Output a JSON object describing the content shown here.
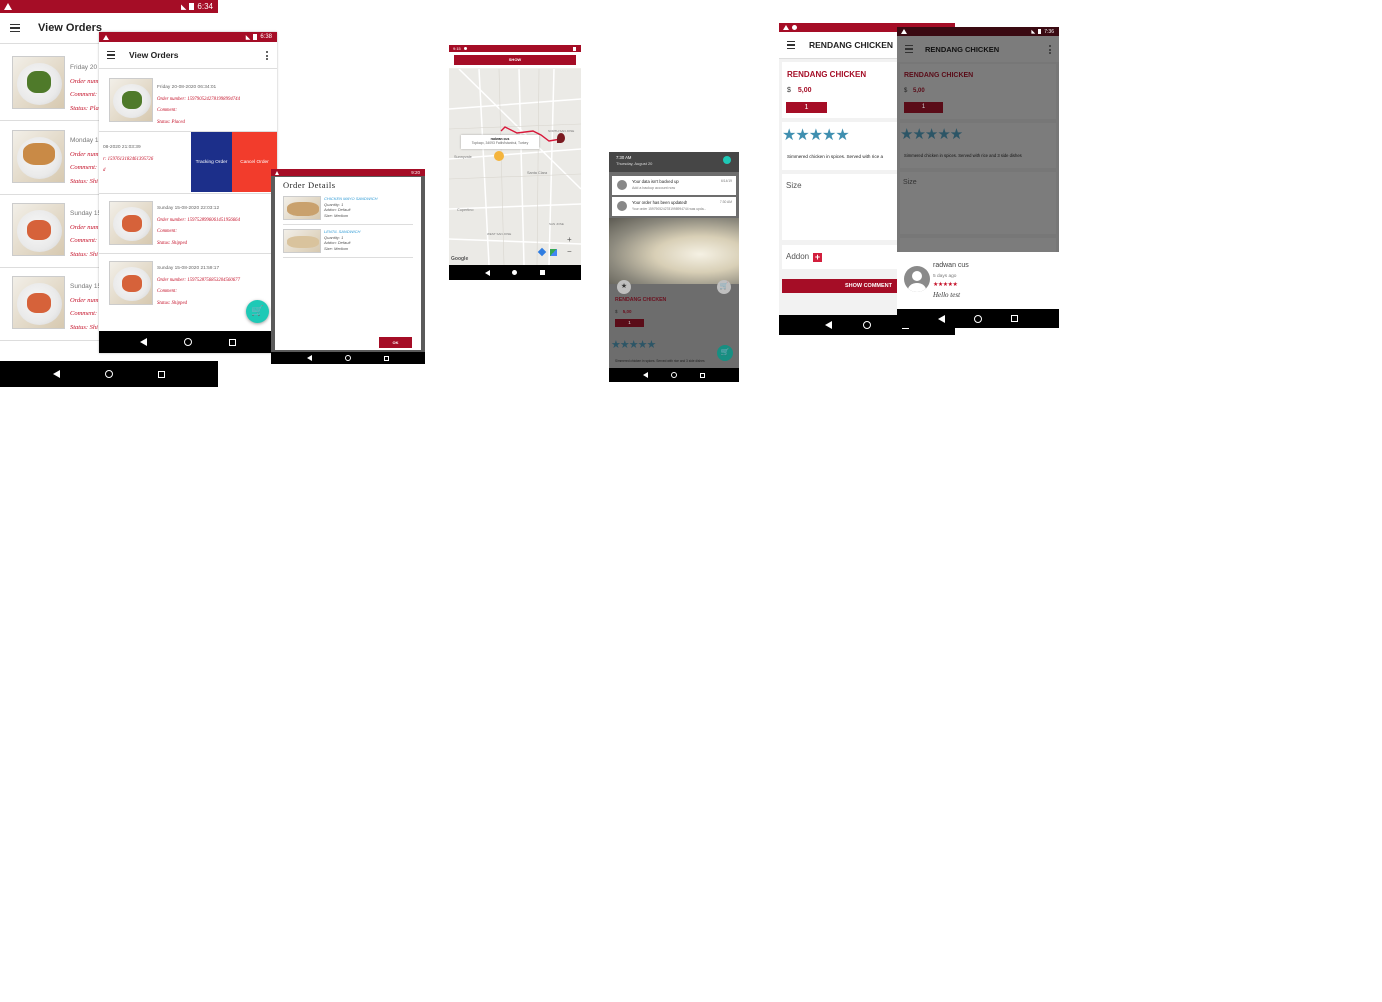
{
  "screen1": {
    "status_time": "6:34",
    "title": "View Orders",
    "rows": [
      {
        "date": "Friday 20",
        "order": "Order num",
        "comment": "Comment:",
        "status": "Status: Plac"
      },
      {
        "date": "Monday 1",
        "order": "Order num",
        "comment": "Comment:",
        "status": "Status: Shi"
      },
      {
        "date": "Sunday 15",
        "order": "Order num",
        "comment": "Comment:",
        "status": "Status: Shi"
      },
      {
        "date": "Sunday 15",
        "order": "Order num",
        "comment": "Comment:",
        "status": "Status: Shi"
      }
    ]
  },
  "screen2": {
    "status_time": "6:38",
    "title": "View Orders",
    "rows": [
      {
        "date": "Friday 20-08-2020 06:34:01",
        "order": "Order number: 1597905242781998994744",
        "comment": "Comment:",
        "status": "Status: Placed"
      },
      {
        "date": "08-2020 21:03:39",
        "order": "r: 1597613182461395726",
        "comment": "",
        "status": "d"
      },
      {
        "date": "Sunday 15-08-2020 22:03:12",
        "order": "Order number: 1597528996061451956664",
        "comment": "Comment:",
        "status": "Status: Shipped"
      },
      {
        "date": "Sunday 15-08-2020 21:59:17",
        "order": "Order number: 1597528756853204560677",
        "comment": "Comment:",
        "status": "Status: Shipped"
      }
    ],
    "swipe_tracking": "Tracking Order",
    "swipe_cancel": "Cancel Order"
  },
  "screen3": {
    "status_time": "9:20",
    "title": "Order Details",
    "items": [
      {
        "name": "CHICKEN MAYO SANDWICH",
        "quantity": "Quantity: 1",
        "addon": "Addon: Default",
        "size": "Size: Medium"
      },
      {
        "name": "LENTIL SANDWICH",
        "quantity": "Quantity: 1",
        "addon": "Addon: Default",
        "size": "Size: Medium"
      }
    ],
    "ok_label": "OK"
  },
  "screen4": {
    "status_time": "9:15",
    "show_label": "SHOW",
    "marker_title": "radwan cus",
    "marker_address": "Topkapı, 34093 Fatih/İstanbul, Turkey",
    "map_labels": [
      "Sunnyvale",
      "Santa Clara",
      "Cupertino",
      "NORTH SAN JOSE",
      "WEST SAN JOSE",
      "SAN JOSE"
    ],
    "google": "Google",
    "zoom_in": "+",
    "zoom_out": "−"
  },
  "screen5": {
    "time": "7:30 AM",
    "date": "Thursday, August 20",
    "notif1_title": "Your data isn't backed up",
    "notif1_sub": "Add a backup account now",
    "notif1_time": "6/14/19",
    "notif2_title": "Your order has been updated!",
    "notif2_sub": "Your order 1597905242781998994744 was upda...",
    "notif2_time": "7:30 AM",
    "food_name": "RENDANG CHICKEN",
    "currency": "$",
    "price": "5,00",
    "qty": "1",
    "desc": "Simmered chicken in spices. Served with rice and 3 side dishes"
  },
  "screen6": {
    "title": "RENDANG CHICKEN",
    "food_name": "RENDANG CHICKEN",
    "currency": "$",
    "price": "5,00",
    "qty": "1",
    "desc": "Simmered chicken in spices. Served with rice a",
    "size_label": "Size",
    "addon_label": "Addon",
    "show_comment": "SHOW COMMENT"
  },
  "screen7": {
    "status_time": "7:36",
    "title": "RENDANG CHICKEN",
    "food_name": "RENDANG CHICKEN",
    "currency": "$",
    "price": "5,00",
    "qty": "1",
    "desc": "Simmered chicken in spices. Served with rice and 3 side dishes",
    "size_label": "Size",
    "comment_user": "radwan cus",
    "comment_time": "5 days ago",
    "comment_text": "Hello test"
  },
  "colors": {
    "primary": "#a50d26",
    "accent": "#1ec9b6",
    "star": "#3f8fb0",
    "swipe_blue": "#1c2f8a",
    "swipe_red": "#f23c2c"
  },
  "stars": "★★★★★",
  "small_stars": "★★★★★"
}
